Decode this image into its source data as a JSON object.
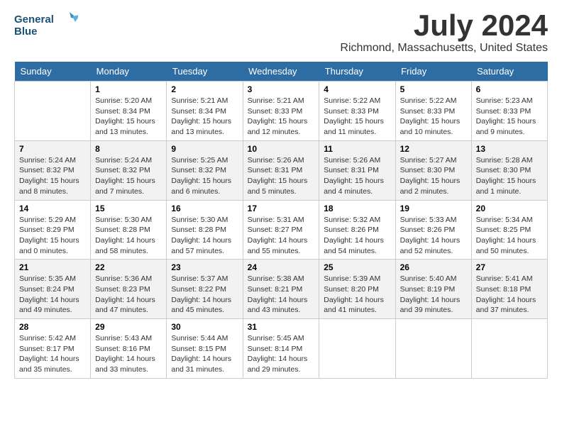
{
  "logo": {
    "line1": "General",
    "line2": "Blue"
  },
  "title": {
    "month_year": "July 2024",
    "location": "Richmond, Massachusetts, United States"
  },
  "days_header": [
    "Sunday",
    "Monday",
    "Tuesday",
    "Wednesday",
    "Thursday",
    "Friday",
    "Saturday"
  ],
  "weeks": [
    [
      {
        "day": "",
        "info": ""
      },
      {
        "day": "1",
        "info": "Sunrise: 5:20 AM\nSunset: 8:34 PM\nDaylight: 15 hours\nand 13 minutes."
      },
      {
        "day": "2",
        "info": "Sunrise: 5:21 AM\nSunset: 8:34 PM\nDaylight: 15 hours\nand 13 minutes."
      },
      {
        "day": "3",
        "info": "Sunrise: 5:21 AM\nSunset: 8:33 PM\nDaylight: 15 hours\nand 12 minutes."
      },
      {
        "day": "4",
        "info": "Sunrise: 5:22 AM\nSunset: 8:33 PM\nDaylight: 15 hours\nand 11 minutes."
      },
      {
        "day": "5",
        "info": "Sunrise: 5:22 AM\nSunset: 8:33 PM\nDaylight: 15 hours\nand 10 minutes."
      },
      {
        "day": "6",
        "info": "Sunrise: 5:23 AM\nSunset: 8:33 PM\nDaylight: 15 hours\nand 9 minutes."
      }
    ],
    [
      {
        "day": "7",
        "info": "Sunrise: 5:24 AM\nSunset: 8:32 PM\nDaylight: 15 hours\nand 8 minutes."
      },
      {
        "day": "8",
        "info": "Sunrise: 5:24 AM\nSunset: 8:32 PM\nDaylight: 15 hours\nand 7 minutes."
      },
      {
        "day": "9",
        "info": "Sunrise: 5:25 AM\nSunset: 8:32 PM\nDaylight: 15 hours\nand 6 minutes."
      },
      {
        "day": "10",
        "info": "Sunrise: 5:26 AM\nSunset: 8:31 PM\nDaylight: 15 hours\nand 5 minutes."
      },
      {
        "day": "11",
        "info": "Sunrise: 5:26 AM\nSunset: 8:31 PM\nDaylight: 15 hours\nand 4 minutes."
      },
      {
        "day": "12",
        "info": "Sunrise: 5:27 AM\nSunset: 8:30 PM\nDaylight: 15 hours\nand 2 minutes."
      },
      {
        "day": "13",
        "info": "Sunrise: 5:28 AM\nSunset: 8:30 PM\nDaylight: 15 hours\nand 1 minute."
      }
    ],
    [
      {
        "day": "14",
        "info": "Sunrise: 5:29 AM\nSunset: 8:29 PM\nDaylight: 15 hours\nand 0 minutes."
      },
      {
        "day": "15",
        "info": "Sunrise: 5:30 AM\nSunset: 8:28 PM\nDaylight: 14 hours\nand 58 minutes."
      },
      {
        "day": "16",
        "info": "Sunrise: 5:30 AM\nSunset: 8:28 PM\nDaylight: 14 hours\nand 57 minutes."
      },
      {
        "day": "17",
        "info": "Sunrise: 5:31 AM\nSunset: 8:27 PM\nDaylight: 14 hours\nand 55 minutes."
      },
      {
        "day": "18",
        "info": "Sunrise: 5:32 AM\nSunset: 8:26 PM\nDaylight: 14 hours\nand 54 minutes."
      },
      {
        "day": "19",
        "info": "Sunrise: 5:33 AM\nSunset: 8:26 PM\nDaylight: 14 hours\nand 52 minutes."
      },
      {
        "day": "20",
        "info": "Sunrise: 5:34 AM\nSunset: 8:25 PM\nDaylight: 14 hours\nand 50 minutes."
      }
    ],
    [
      {
        "day": "21",
        "info": "Sunrise: 5:35 AM\nSunset: 8:24 PM\nDaylight: 14 hours\nand 49 minutes."
      },
      {
        "day": "22",
        "info": "Sunrise: 5:36 AM\nSunset: 8:23 PM\nDaylight: 14 hours\nand 47 minutes."
      },
      {
        "day": "23",
        "info": "Sunrise: 5:37 AM\nSunset: 8:22 PM\nDaylight: 14 hours\nand 45 minutes."
      },
      {
        "day": "24",
        "info": "Sunrise: 5:38 AM\nSunset: 8:21 PM\nDaylight: 14 hours\nand 43 minutes."
      },
      {
        "day": "25",
        "info": "Sunrise: 5:39 AM\nSunset: 8:20 PM\nDaylight: 14 hours\nand 41 minutes."
      },
      {
        "day": "26",
        "info": "Sunrise: 5:40 AM\nSunset: 8:19 PM\nDaylight: 14 hours\nand 39 minutes."
      },
      {
        "day": "27",
        "info": "Sunrise: 5:41 AM\nSunset: 8:18 PM\nDaylight: 14 hours\nand 37 minutes."
      }
    ],
    [
      {
        "day": "28",
        "info": "Sunrise: 5:42 AM\nSunset: 8:17 PM\nDaylight: 14 hours\nand 35 minutes."
      },
      {
        "day": "29",
        "info": "Sunrise: 5:43 AM\nSunset: 8:16 PM\nDaylight: 14 hours\nand 33 minutes."
      },
      {
        "day": "30",
        "info": "Sunrise: 5:44 AM\nSunset: 8:15 PM\nDaylight: 14 hours\nand 31 minutes."
      },
      {
        "day": "31",
        "info": "Sunrise: 5:45 AM\nSunset: 8:14 PM\nDaylight: 14 hours\nand 29 minutes."
      },
      {
        "day": "",
        "info": ""
      },
      {
        "day": "",
        "info": ""
      },
      {
        "day": "",
        "info": ""
      }
    ]
  ]
}
